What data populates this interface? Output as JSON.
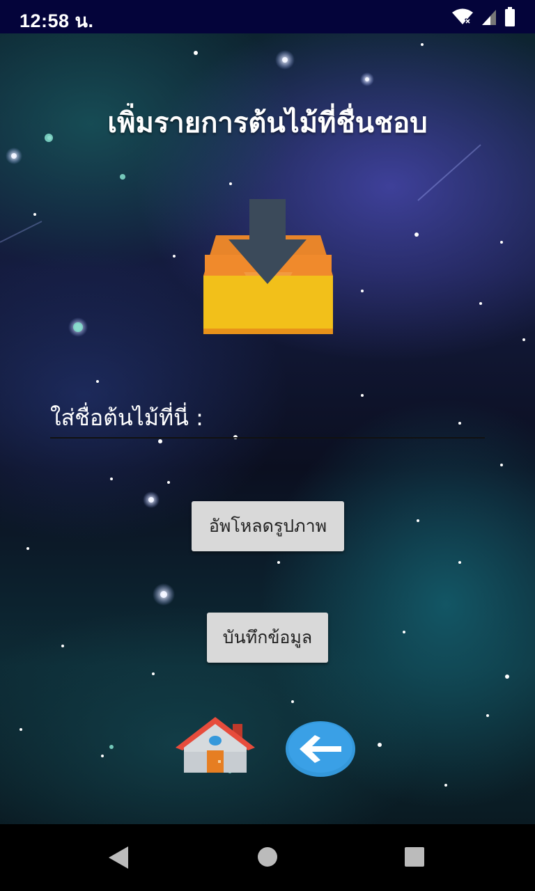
{
  "status_bar": {
    "time": "12:58 น.",
    "icons": [
      "wifi-icon",
      "signal-icon",
      "battery-icon"
    ]
  },
  "screen": {
    "title": "เพิ่มรายการต้นไม้ที่ชื่นชอบ",
    "header_icon": "inbox-download-icon",
    "name_input": {
      "placeholder": "ใส่ชื่อต้นไม้ที่นี่ :",
      "value": ""
    },
    "upload_button_label": "อัพโหลดรูปภาพ",
    "save_button_label": "บันทึกข้อมูล",
    "bottom_icons": [
      "home-icon",
      "back-arrow-icon"
    ]
  },
  "nav_bar": {
    "buttons": [
      "back-triangle-icon",
      "home-circle-icon",
      "recents-square-icon"
    ]
  },
  "colors": {
    "status_bar_bg": "#04043a",
    "button_bg": "#d9d9d9",
    "nav_bar_bg": "#000000",
    "title_text": "#ffffff"
  }
}
